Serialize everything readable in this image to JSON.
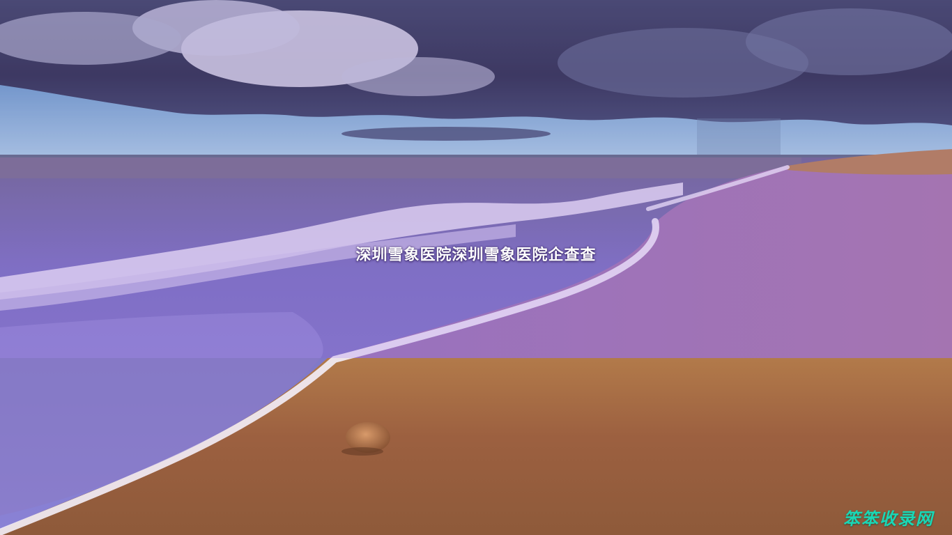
{
  "title": "深圳雪象医院深圳雪象医院企查查",
  "watermark": "笨笨收录网",
  "colors": {
    "sky_top": "#2f3a52",
    "sky_horizon": "#9ec7d9",
    "sea": "#6f6fb8",
    "foam": "#e8e4f4",
    "wet_sand": "#9a6a9a",
    "dry_sand": "#a26a40",
    "overlay": "#965adc",
    "watermark": "#19d8b6"
  }
}
